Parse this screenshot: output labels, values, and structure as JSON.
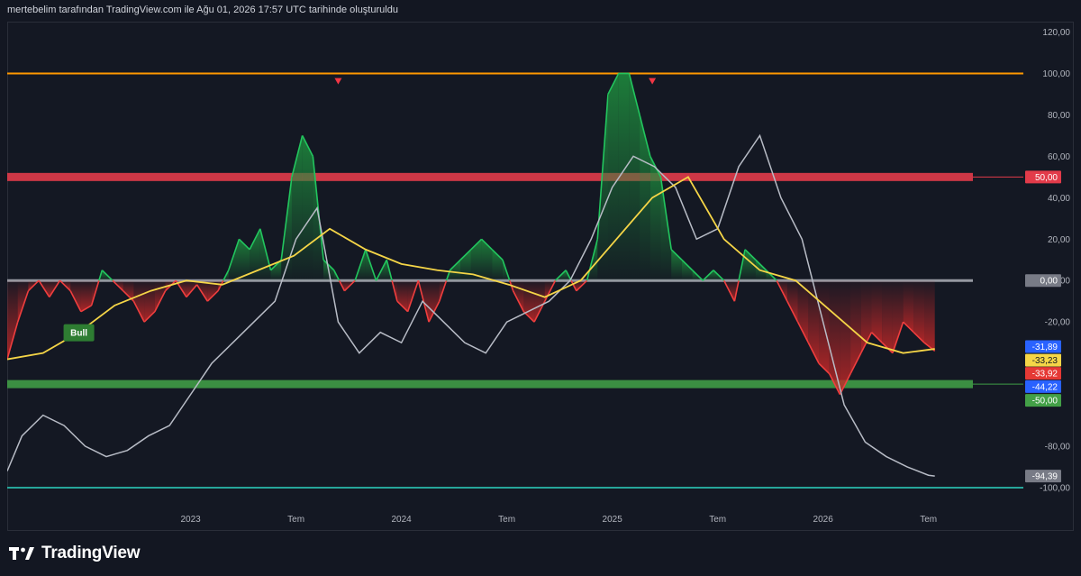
{
  "caption": "mertebelim tarafından TradingView.com ile Ağu 01, 2026 17:57 UTC tarihinde oluşturuldu",
  "brand": {
    "name": "TradingView"
  },
  "colors": {
    "background": "#131722",
    "bull_fill": "#1e8e3e",
    "bear_fill": "#c62828",
    "main_line_up": "#22c55e",
    "main_line_down": "#ef3e3e",
    "signal_line": "#f5d547",
    "gray_line": "#b8bcc6",
    "overbought_line": "#ff9800",
    "minus100_line": "#26a69a",
    "band_red": "#e23b4a",
    "band_green": "#3f9c46",
    "zero_line": "#9598a1"
  },
  "chart_data": {
    "type": "line",
    "ylim": [
      -110,
      125
    ],
    "y_ticks": [
      "120,00",
      "100,00",
      "80,00",
      "60,00",
      "40,00",
      "20,00",
      "0,00",
      "-20,00",
      "-80,00",
      "-100,00"
    ],
    "x_time_labels": [
      "2023",
      "Tem",
      "2024",
      "Tem",
      "2025",
      "Tem",
      "2026",
      "Tem"
    ],
    "x_time_positions": [
      2023.0,
      2023.5,
      2024.0,
      2024.5,
      2025.0,
      2025.5,
      2026.0,
      2026.5
    ],
    "xlim": [
      2022.13,
      2026.95
    ],
    "horizontal_levels": [
      {
        "value": 100,
        "color": "#ff9800"
      },
      {
        "value": 50,
        "color": "#e23b4a"
      },
      {
        "value": 0,
        "color": "#9598a1"
      },
      {
        "value": -50,
        "color": "#3f9c46"
      },
      {
        "value": -100,
        "color": "#26a69a"
      }
    ],
    "price_tags": [
      {
        "label": "50,00",
        "value": 50,
        "bg": "#e23b4a",
        "fg": "#ffffff"
      },
      {
        "label": "0,00",
        "value": 0,
        "bg": "#787b86",
        "fg": "#ffffff"
      },
      {
        "label": "-31,89",
        "value": -31.89,
        "bg": "#2962ff",
        "fg": "#ffffff"
      },
      {
        "label": "-33,23",
        "value": -33.23,
        "bg": "#f5d547",
        "fg": "#131722"
      },
      {
        "label": "-33,92",
        "value": -33.92,
        "bg": "#e53935",
        "fg": "#ffffff"
      },
      {
        "label": "-44,22",
        "value": -44.22,
        "bg": "#2962ff",
        "fg": "#ffffff"
      },
      {
        "label": "-50,00",
        "value": -50,
        "bg": "#43a047",
        "fg": "#ffffff"
      },
      {
        "label": "-94,39",
        "value": -94.39,
        "bg": "#787b86",
        "fg": "#ffffff"
      }
    ],
    "bull_label": {
      "text": "Bull",
      "x": 2022.47,
      "y": -25
    },
    "markers": [
      {
        "type": "down-triangle",
        "x": 2023.7,
        "y": 96
      },
      {
        "type": "down-triangle",
        "x": 2025.19,
        "y": 96
      }
    ],
    "series": [
      {
        "role": "main-oscillator",
        "x": [
          2022.13,
          2022.18,
          2022.23,
          2022.28,
          2022.33,
          2022.38,
          2022.43,
          2022.48,
          2022.53,
          2022.58,
          2022.63,
          2022.68,
          2022.73,
          2022.78,
          2022.83,
          2022.88,
          2022.93,
          2022.98,
          2023.03,
          2023.08,
          2023.13,
          2023.18,
          2023.23,
          2023.28,
          2023.33,
          2023.38,
          2023.43,
          2023.48,
          2023.53,
          2023.58,
          2023.63,
          2023.68,
          2023.73,
          2023.78,
          2023.83,
          2023.88,
          2023.93,
          2023.98,
          2024.03,
          2024.08,
          2024.13,
          2024.18,
          2024.23,
          2024.28,
          2024.33,
          2024.38,
          2024.43,
          2024.48,
          2024.53,
          2024.58,
          2024.63,
          2024.68,
          2024.73,
          2024.78,
          2024.83,
          2024.88,
          2024.93,
          2024.98,
          2025.03,
          2025.08,
          2025.13,
          2025.18,
          2025.23,
          2025.28,
          2025.33,
          2025.38,
          2025.43,
          2025.48,
          2025.53,
          2025.58,
          2025.63,
          2025.68,
          2025.73,
          2025.78,
          2025.83,
          2025.88,
          2025.93,
          2025.98,
          2026.03,
          2026.08,
          2026.13,
          2026.18,
          2026.23,
          2026.28,
          2026.33,
          2026.38,
          2026.43,
          2026.48,
          2026.53
        ],
        "y": [
          -38,
          -20,
          -5,
          0,
          -8,
          0,
          -5,
          -15,
          -12,
          5,
          0,
          -5,
          -10,
          -20,
          -15,
          -5,
          0,
          -8,
          -2,
          -10,
          -5,
          5,
          20,
          15,
          25,
          5,
          10,
          50,
          70,
          60,
          10,
          5,
          -5,
          0,
          15,
          0,
          10,
          -10,
          -15,
          0,
          -20,
          -10,
          5,
          10,
          15,
          20,
          15,
          10,
          -5,
          -15,
          -20,
          -10,
          0,
          5,
          -5,
          0,
          20,
          90,
          100,
          100,
          80,
          60,
          50,
          15,
          10,
          5,
          0,
          5,
          0,
          -10,
          15,
          10,
          5,
          0,
          -10,
          -20,
          -30,
          -40,
          -45,
          -55,
          -45,
          -35,
          -25,
          -30,
          -35,
          -20,
          -25,
          -30,
          -34
        ]
      },
      {
        "role": "signal",
        "x": [
          2022.13,
          2022.3,
          2022.47,
          2022.64,
          2022.81,
          2022.98,
          2023.15,
          2023.32,
          2023.49,
          2023.66,
          2023.83,
          2024.0,
          2024.17,
          2024.34,
          2024.51,
          2024.68,
          2024.85,
          2025.02,
          2025.19,
          2025.36,
          2025.53,
          2025.7,
          2025.87,
          2026.04,
          2026.21,
          2026.38,
          2026.53
        ],
        "y": [
          -38,
          -35,
          -25,
          -12,
          -5,
          0,
          -2,
          5,
          12,
          25,
          15,
          8,
          5,
          3,
          -2,
          -8,
          0,
          20,
          40,
          50,
          20,
          5,
          0,
          -15,
          -30,
          -35,
          -33
        ]
      },
      {
        "role": "gray-line",
        "x": [
          2022.13,
          2022.2,
          2022.3,
          2022.4,
          2022.5,
          2022.6,
          2022.7,
          2022.8,
          2022.9,
          2023.0,
          2023.1,
          2023.2,
          2023.3,
          2023.4,
          2023.5,
          2023.6,
          2023.7,
          2023.8,
          2023.9,
          2024.0,
          2024.1,
          2024.2,
          2024.3,
          2024.4,
          2024.5,
          2024.6,
          2024.7,
          2024.8,
          2024.9,
          2025.0,
          2025.1,
          2025.2,
          2025.3,
          2025.4,
          2025.5,
          2025.6,
          2025.7,
          2025.8,
          2025.9,
          2026.0,
          2026.1,
          2026.2,
          2026.3,
          2026.4,
          2026.5,
          2026.53
        ],
        "y": [
          -92,
          -75,
          -65,
          -70,
          -80,
          -85,
          -82,
          -75,
          -70,
          -55,
          -40,
          -30,
          -20,
          -10,
          20,
          35,
          -20,
          -35,
          -25,
          -30,
          -10,
          -20,
          -30,
          -35,
          -20,
          -15,
          -10,
          0,
          20,
          45,
          60,
          55,
          45,
          20,
          25,
          55,
          70,
          40,
          20,
          -20,
          -60,
          -78,
          -85,
          -90,
          -94,
          -94.39
        ]
      }
    ]
  }
}
